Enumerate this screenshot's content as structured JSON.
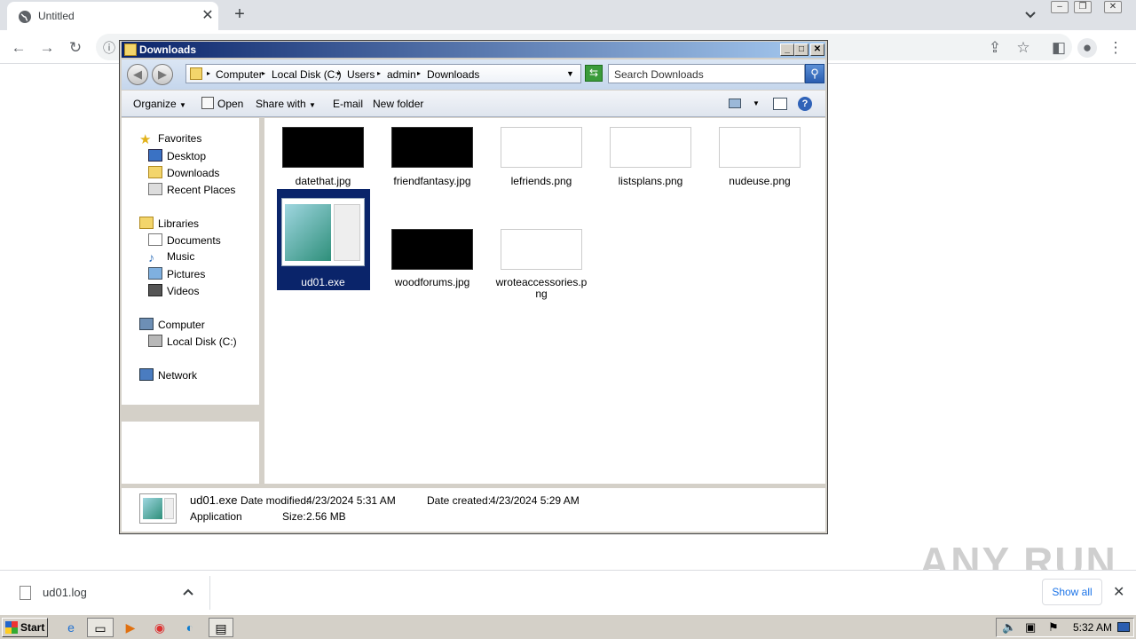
{
  "browser": {
    "tab_title": "Untitled",
    "new_tab": "+",
    "tab_close": "✕"
  },
  "explorer": {
    "window_title": "Downloads",
    "breadcrumbs": [
      "Computer",
      "Local Disk (C:)",
      "Users",
      "admin",
      "Downloads"
    ],
    "search_placeholder": "Search Downloads",
    "commands": {
      "organize": "Organize",
      "open": "Open",
      "share_with": "Share with",
      "email": "E-mail",
      "new_folder": "New folder"
    },
    "nav": {
      "favorites": "Favorites",
      "desktop": "Desktop",
      "downloads": "Downloads",
      "recent_places": "Recent Places",
      "libraries": "Libraries",
      "documents": "Documents",
      "music": "Music",
      "pictures": "Pictures",
      "videos": "Videos",
      "computer": "Computer",
      "local_disk": "Local Disk (C:)",
      "network": "Network"
    },
    "files": [
      {
        "name": "datethat.jpg"
      },
      {
        "name": "friendfantasy.jpg"
      },
      {
        "name": "lefriends.png"
      },
      {
        "name": "listsplans.png"
      },
      {
        "name": "nudeuse.png"
      },
      {
        "name": "ud01.exe"
      },
      {
        "name": "woodforums.jpg"
      },
      {
        "name": "wroteaccessories.png"
      }
    ],
    "details": {
      "name": "ud01.exe",
      "modified_label": "Date modified:",
      "modified": "4/23/2024 5:31 AM",
      "created_label": "Date created:",
      "created": "4/23/2024 5:29 AM",
      "type": "Application",
      "size_label": "Size:",
      "size": "2.56 MB"
    }
  },
  "download_bar": {
    "file": "ud01.log",
    "show_all": "Show all"
  },
  "taskbar": {
    "start": "Start",
    "clock": "5:32 AM"
  },
  "watermark": "ANY RUN"
}
